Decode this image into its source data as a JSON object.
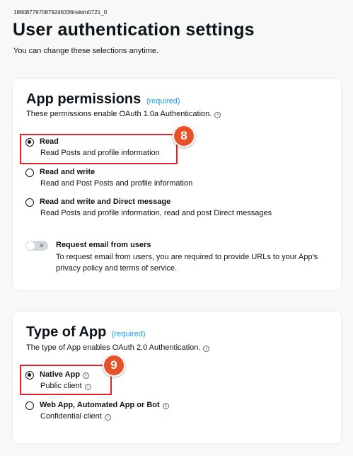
{
  "header": {
    "app_id": "1860877970879246336nskim0721_0",
    "title": "User authentication settings",
    "subtitle": "You can change these selections anytime."
  },
  "permissions": {
    "title": "App permissions",
    "required": "(required)",
    "description": "These permissions enable OAuth 1.0a Authentication.",
    "options": [
      {
        "label": "Read",
        "description": "Read Posts and profile information",
        "checked": true
      },
      {
        "label": "Read and write",
        "description": "Read and Post Posts and profile information",
        "checked": false
      },
      {
        "label": "Read and write and Direct message",
        "description": "Read Posts and profile information, read and post Direct messages",
        "checked": false
      }
    ],
    "email": {
      "label": "Request email from users",
      "description": "To request email from users, you are required to provide URLs to your App's privacy policy and terms of service.",
      "enabled": false
    }
  },
  "app_type": {
    "title": "Type of App",
    "required": "(required)",
    "description": "The type of App enables OAuth 2.0 Authentication.",
    "options": [
      {
        "label": "Native App",
        "description": "Public client",
        "checked": true
      },
      {
        "label": "Web App, Automated App or Bot",
        "description": "Confidential client",
        "checked": false
      }
    ]
  },
  "annotations": {
    "marker_1": "8",
    "marker_2": "9"
  },
  "colors": {
    "accent": "#1d9bf0",
    "highlight": "#e8222b",
    "marker": "#e8522b"
  }
}
